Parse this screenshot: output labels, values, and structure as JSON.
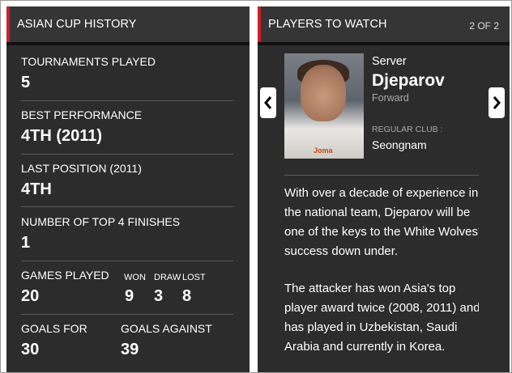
{
  "left_panel": {
    "title": "ASIAN CUP HISTORY",
    "stats": [
      {
        "label": "TOURNAMENTS PLAYED",
        "value": "5"
      },
      {
        "label": "BEST PERFORMANCE",
        "value": "4TH (2011)"
      },
      {
        "label": "LAST POSITION (2011)",
        "value": "4TH"
      },
      {
        "label": "NUMBER OF TOP 4 FINISHES",
        "value": "1"
      }
    ],
    "games": {
      "label": "GAMES PLAYED",
      "value": "20",
      "won_label": "WON",
      "won": "9",
      "draw_label": "DRAW",
      "draw": "3",
      "lost_label": "LOST",
      "lost": "8"
    },
    "goals": {
      "for_label": "GOALS FOR",
      "for_value": "30",
      "against_label": "GOALS AGAINST",
      "against_value": "39"
    }
  },
  "right_panel": {
    "title": "PLAYERS TO WATCH",
    "pagination": "2 OF 2",
    "player": {
      "first_name": "Server",
      "last_name": "Djeparov",
      "position": "Forward",
      "club_label": "REGULAR CLUB :",
      "club": "Seongnam",
      "shirt_logo": "Joma"
    },
    "bio_lines": [
      "With over a decade of experience in",
      "the national team, Djeparov will be",
      "one of the keys to the White Wolves'",
      "success down under.",
      "",
      "The attacker has won Asia's top",
      "player award twice (2008, 2011) and",
      "has played in Uzbekistan, Saudi",
      "Arabia and currently in Korea."
    ]
  },
  "colors": {
    "panel_bg": "#2c2c2c",
    "header_bg": "#353535",
    "accent_red": "#cc1f2a",
    "divider": "#5b5b5b"
  },
  "icons": {
    "prev": "chevron-left-icon",
    "next": "chevron-right-icon"
  }
}
